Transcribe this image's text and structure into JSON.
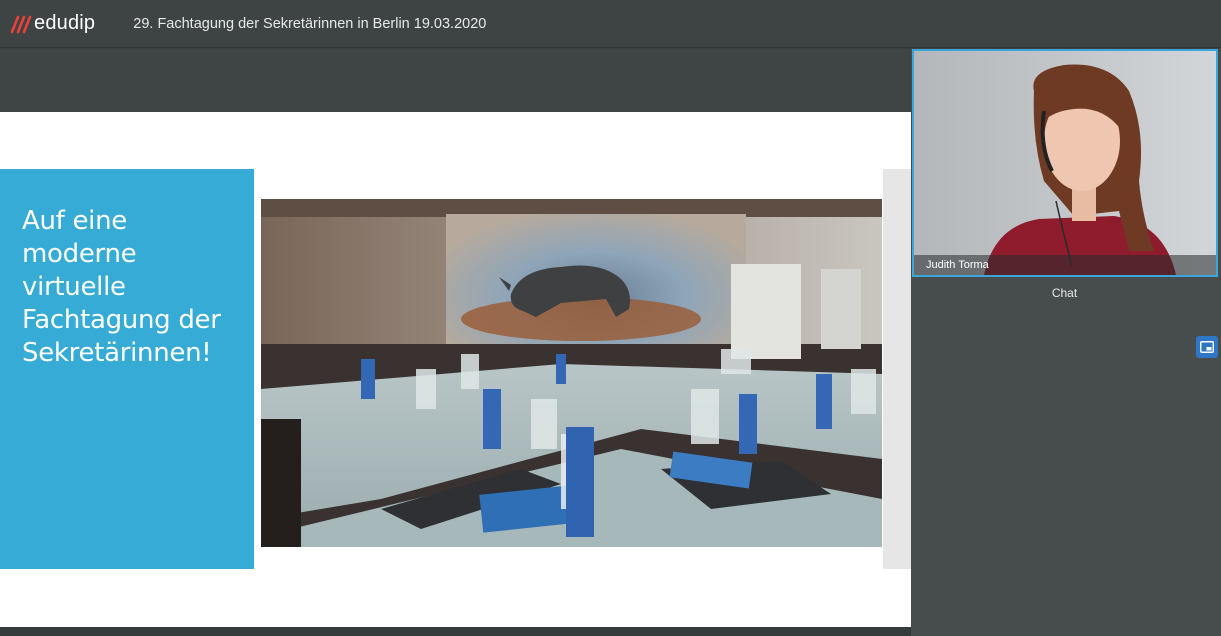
{
  "header": {
    "brand": "edudip",
    "event_title": "29. Fachtagung der Sekretärinnen in Berlin 19.03.2020"
  },
  "slide": {
    "heading_lines": [
      "Auf eine",
      "moderne",
      "virtuelle",
      "Fachtagung der",
      "Sekretärinnen!"
    ],
    "band_color": "#35abd6"
  },
  "video": {
    "participant_name": "Judith Torma"
  },
  "panel": {
    "chat_label": "Chat",
    "popout_icon": "popout-window-icon"
  },
  "colors": {
    "accent": "#3ba6dc",
    "brand_mark": "#e8423a",
    "button": "#2f77c6"
  }
}
